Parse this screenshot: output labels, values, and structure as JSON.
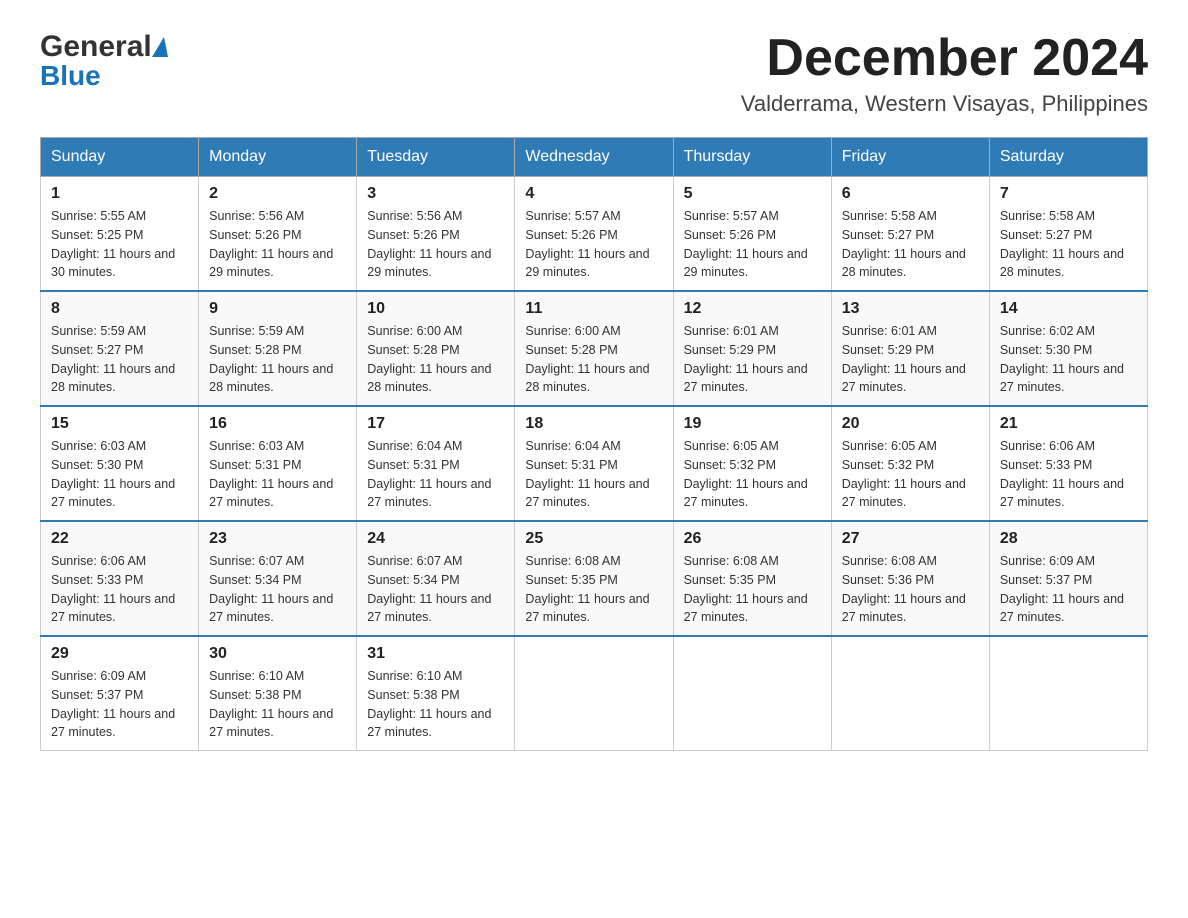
{
  "header": {
    "logo_general": "General",
    "logo_blue": "Blue",
    "month_title": "December 2024",
    "location": "Valderrama, Western Visayas, Philippines"
  },
  "days_of_week": [
    "Sunday",
    "Monday",
    "Tuesday",
    "Wednesday",
    "Thursday",
    "Friday",
    "Saturday"
  ],
  "weeks": [
    [
      {
        "day": "1",
        "sunrise": "5:55 AM",
        "sunset": "5:25 PM",
        "daylight": "11 hours and 30 minutes."
      },
      {
        "day": "2",
        "sunrise": "5:56 AM",
        "sunset": "5:26 PM",
        "daylight": "11 hours and 29 minutes."
      },
      {
        "day": "3",
        "sunrise": "5:56 AM",
        "sunset": "5:26 PM",
        "daylight": "11 hours and 29 minutes."
      },
      {
        "day": "4",
        "sunrise": "5:57 AM",
        "sunset": "5:26 PM",
        "daylight": "11 hours and 29 minutes."
      },
      {
        "day": "5",
        "sunrise": "5:57 AM",
        "sunset": "5:26 PM",
        "daylight": "11 hours and 29 minutes."
      },
      {
        "day": "6",
        "sunrise": "5:58 AM",
        "sunset": "5:27 PM",
        "daylight": "11 hours and 28 minutes."
      },
      {
        "day": "7",
        "sunrise": "5:58 AM",
        "sunset": "5:27 PM",
        "daylight": "11 hours and 28 minutes."
      }
    ],
    [
      {
        "day": "8",
        "sunrise": "5:59 AM",
        "sunset": "5:27 PM",
        "daylight": "11 hours and 28 minutes."
      },
      {
        "day": "9",
        "sunrise": "5:59 AM",
        "sunset": "5:28 PM",
        "daylight": "11 hours and 28 minutes."
      },
      {
        "day": "10",
        "sunrise": "6:00 AM",
        "sunset": "5:28 PM",
        "daylight": "11 hours and 28 minutes."
      },
      {
        "day": "11",
        "sunrise": "6:00 AM",
        "sunset": "5:28 PM",
        "daylight": "11 hours and 28 minutes."
      },
      {
        "day": "12",
        "sunrise": "6:01 AM",
        "sunset": "5:29 PM",
        "daylight": "11 hours and 27 minutes."
      },
      {
        "day": "13",
        "sunrise": "6:01 AM",
        "sunset": "5:29 PM",
        "daylight": "11 hours and 27 minutes."
      },
      {
        "day": "14",
        "sunrise": "6:02 AM",
        "sunset": "5:30 PM",
        "daylight": "11 hours and 27 minutes."
      }
    ],
    [
      {
        "day": "15",
        "sunrise": "6:03 AM",
        "sunset": "5:30 PM",
        "daylight": "11 hours and 27 minutes."
      },
      {
        "day": "16",
        "sunrise": "6:03 AM",
        "sunset": "5:31 PM",
        "daylight": "11 hours and 27 minutes."
      },
      {
        "day": "17",
        "sunrise": "6:04 AM",
        "sunset": "5:31 PM",
        "daylight": "11 hours and 27 minutes."
      },
      {
        "day": "18",
        "sunrise": "6:04 AM",
        "sunset": "5:31 PM",
        "daylight": "11 hours and 27 minutes."
      },
      {
        "day": "19",
        "sunrise": "6:05 AM",
        "sunset": "5:32 PM",
        "daylight": "11 hours and 27 minutes."
      },
      {
        "day": "20",
        "sunrise": "6:05 AM",
        "sunset": "5:32 PM",
        "daylight": "11 hours and 27 minutes."
      },
      {
        "day": "21",
        "sunrise": "6:06 AM",
        "sunset": "5:33 PM",
        "daylight": "11 hours and 27 minutes."
      }
    ],
    [
      {
        "day": "22",
        "sunrise": "6:06 AM",
        "sunset": "5:33 PM",
        "daylight": "11 hours and 27 minutes."
      },
      {
        "day": "23",
        "sunrise": "6:07 AM",
        "sunset": "5:34 PM",
        "daylight": "11 hours and 27 minutes."
      },
      {
        "day": "24",
        "sunrise": "6:07 AM",
        "sunset": "5:34 PM",
        "daylight": "11 hours and 27 minutes."
      },
      {
        "day": "25",
        "sunrise": "6:08 AM",
        "sunset": "5:35 PM",
        "daylight": "11 hours and 27 minutes."
      },
      {
        "day": "26",
        "sunrise": "6:08 AM",
        "sunset": "5:35 PM",
        "daylight": "11 hours and 27 minutes."
      },
      {
        "day": "27",
        "sunrise": "6:08 AM",
        "sunset": "5:36 PM",
        "daylight": "11 hours and 27 minutes."
      },
      {
        "day": "28",
        "sunrise": "6:09 AM",
        "sunset": "5:37 PM",
        "daylight": "11 hours and 27 minutes."
      }
    ],
    [
      {
        "day": "29",
        "sunrise": "6:09 AM",
        "sunset": "5:37 PM",
        "daylight": "11 hours and 27 minutes."
      },
      {
        "day": "30",
        "sunrise": "6:10 AM",
        "sunset": "5:38 PM",
        "daylight": "11 hours and 27 minutes."
      },
      {
        "day": "31",
        "sunrise": "6:10 AM",
        "sunset": "5:38 PM",
        "daylight": "11 hours and 27 minutes."
      },
      null,
      null,
      null,
      null
    ]
  ]
}
